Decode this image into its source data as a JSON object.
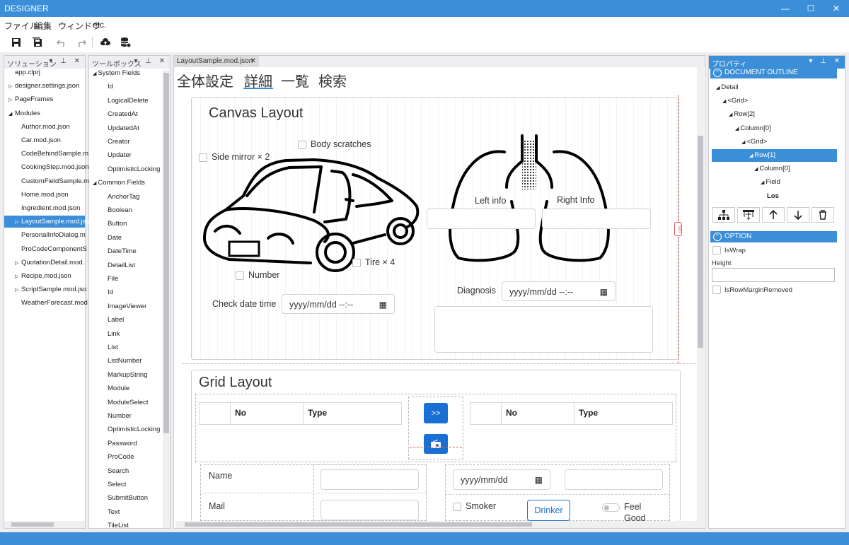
{
  "app": {
    "title": "DESIGNER",
    "window_buttons": [
      "—",
      "☐",
      "✕"
    ]
  },
  "menu": [
    "ファイル",
    "編集",
    "ウィンドウ",
    "etc."
  ],
  "toolbar": {
    "icons": [
      "save-icon",
      "save-all-icon",
      "undo-icon",
      "redo-icon",
      "cloud-upload-icon",
      "database-icon"
    ]
  },
  "solution_panel": {
    "title": "ソリューション",
    "items": [
      {
        "label": "app.clprj",
        "indent": 0,
        "arrow": ""
      },
      {
        "label": "designer.settings.json",
        "indent": 0,
        "arrow": "▷"
      },
      {
        "label": "PageFrames",
        "indent": 0,
        "arrow": "▷"
      },
      {
        "label": "Modules",
        "indent": 0,
        "arrow": "◢"
      },
      {
        "label": "Author.mod.json",
        "indent": 1,
        "arrow": ""
      },
      {
        "label": "Car.mod.json",
        "indent": 1,
        "arrow": ""
      },
      {
        "label": "CodeBehindSample.m",
        "indent": 1,
        "arrow": ""
      },
      {
        "label": "CookingStep.mod.json",
        "indent": 1,
        "arrow": ""
      },
      {
        "label": "CustomFieldSample.m",
        "indent": 1,
        "arrow": ""
      },
      {
        "label": "Home.mod.json",
        "indent": 1,
        "arrow": ""
      },
      {
        "label": "Ingredient.mod.json",
        "indent": 1,
        "arrow": ""
      },
      {
        "label": "LayoutSample.mod.json",
        "indent": 1,
        "arrow": "▷",
        "selected": true
      },
      {
        "label": "PersonalInfoDialog.m",
        "indent": 1,
        "arrow": ""
      },
      {
        "label": "ProCodeComponentS",
        "indent": 1,
        "arrow": ""
      },
      {
        "label": "QuotationDetail.mod.",
        "indent": 1,
        "arrow": "▷"
      },
      {
        "label": "Recipe.mod.json",
        "indent": 1,
        "arrow": "▷"
      },
      {
        "label": "ScriptSample.mod.jso",
        "indent": 1,
        "arrow": "▷"
      },
      {
        "label": "WeatherForecast.mod",
        "indent": 1,
        "arrow": ""
      }
    ]
  },
  "toolbox_panel": {
    "title": "ツールボックス",
    "groups": [
      {
        "label": "System Fields",
        "items": [
          "Id",
          "LogicalDelete",
          "CreatedAt",
          "UpdatedAt",
          "Creator",
          "Updater",
          "OptimisticLocking"
        ]
      },
      {
        "label": "Common Fields",
        "items": [
          "AnchorTag",
          "Boolean",
          "Button",
          "Date",
          "DateTime",
          "DetailList",
          "File",
          "Id",
          "ImageViewer",
          "Label",
          "Link",
          "List",
          "ListNumber",
          "MarkupString",
          "Module",
          "ModuleSelect",
          "Number",
          "OptimisticLocking",
          "Password",
          "ProCode",
          "Search",
          "Select",
          "SubmitButton",
          "Text",
          "TileList"
        ]
      }
    ]
  },
  "document_tab": {
    "label": "LayoutSample.mod.json",
    "close": "✕"
  },
  "designer": {
    "tabs": [
      "全体設定",
      "詳細",
      "一覧",
      "検索"
    ],
    "active_tab": 1,
    "ruler_label": "500",
    "canvas": {
      "title": "Canvas Layout",
      "side_mirror": "Side mirror × 2",
      "body_scratches": "Body scratches",
      "number": "Number",
      "tire": "Tire × 4",
      "left_info": "Left info",
      "right_info": "Right Info",
      "check_date_label": "Check date time",
      "check_date_placeholder": "yyyy/mm/dd --:--",
      "diagnosis_label": "Diagnosis",
      "diagnosis_placeholder": "yyyy/mm/dd --:--"
    },
    "grid": {
      "title": "Grid Layout",
      "left_table_headers": [
        "",
        "No",
        "Type"
      ],
      "right_table_headers": [
        "",
        "No",
        "Type"
      ],
      "move_right_button": ">>",
      "name_label": "Name",
      "mail_label": "Mail",
      "date_placeholder": "yyyy/mm/dd",
      "smoker_label": "Smoker",
      "drinker_button": "Drinker",
      "feel_good_label": "Feel Good"
    }
  },
  "properties_panel": {
    "title": "プロパティ",
    "outline_title": "DOCUMENT OUTLINE",
    "outline": [
      {
        "label": "Detail",
        "depth": 0
      },
      {
        "label": "<Grid>",
        "depth": 1
      },
      {
        "label": "Row[2]",
        "depth": 2
      },
      {
        "label": "Column[0]",
        "depth": 3
      },
      {
        "label": "<Grid>",
        "depth": 4
      },
      {
        "label": "Row[1]",
        "depth": 5,
        "selected": true
      },
      {
        "label": "Column[0]",
        "depth": 6
      },
      {
        "label": "Field",
        "depth": 7
      },
      {
        "label": "Los",
        "depth": 8
      }
    ],
    "option_title": "OPTION",
    "is_wrap": "IsWrap",
    "height": "Height",
    "is_row_margin_removed": "IsRowMarginRemoved"
  },
  "colors": {
    "accent": "#3b8fd8",
    "button_blue": "#1a6fd4",
    "selection": "#3b8fd8"
  }
}
